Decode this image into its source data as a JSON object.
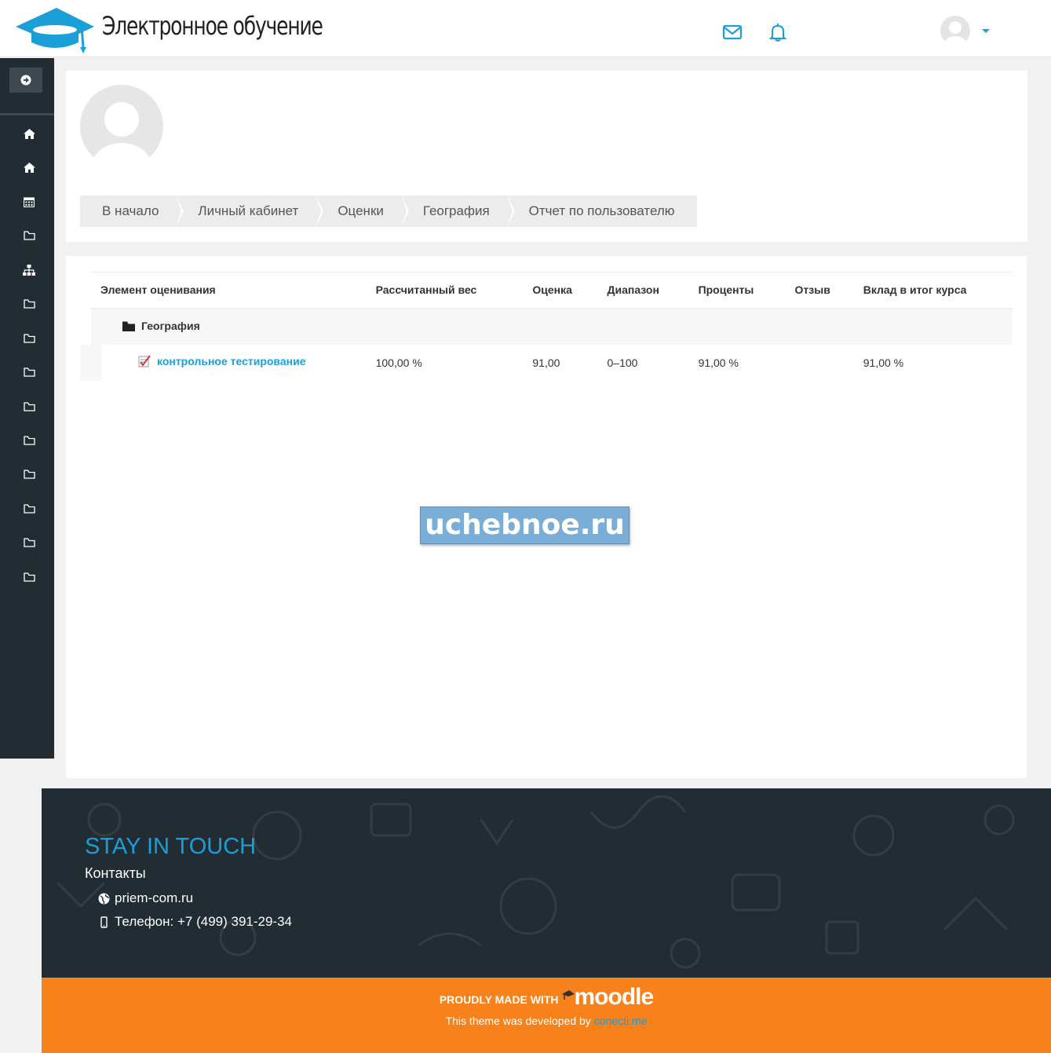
{
  "header": {
    "site_title": "Электронное обучение",
    "icons": [
      "mail-icon",
      "bell-icon",
      "user-avatar"
    ]
  },
  "sidebar": {
    "items": [
      {
        "icon": "home-icon"
      },
      {
        "icon": "home-icon"
      },
      {
        "icon": "calendar-icon"
      },
      {
        "icon": "folder-icon"
      },
      {
        "icon": "sitemap-icon"
      },
      {
        "icon": "folder-icon"
      },
      {
        "icon": "folder-icon"
      },
      {
        "icon": "folder-icon"
      },
      {
        "icon": "folder-icon"
      },
      {
        "icon": "folder-icon"
      },
      {
        "icon": "folder-icon"
      },
      {
        "icon": "folder-icon"
      },
      {
        "icon": "folder-icon"
      },
      {
        "icon": "folder-icon"
      }
    ]
  },
  "breadcrumb": [
    "В начало",
    "Личный кабинет",
    "Оценки",
    "География",
    "Отчет по пользователю"
  ],
  "grades": {
    "headers": [
      "Элемент оценивания",
      "Рассчитанный вес",
      "Оценка",
      "Диапазон",
      "Проценты",
      "Отзыв",
      "Вклад в итог курса"
    ],
    "category": "География",
    "item": {
      "name": "контрольное тестирование",
      "weight": "100,00 %",
      "grade": "91,00",
      "range": "0–100",
      "percent": "91,00 %",
      "feedback": "",
      "contribution": "91,00 %"
    }
  },
  "watermark": "uchebnoe.ru",
  "footer": {
    "stay_title": "STAY IN TOUCH",
    "contacts_heading": "Контакты",
    "website": "priem-com.ru",
    "phone": "Телефон: +7 (499) 391-29-34",
    "made_with": "PROUDLY MADE WITH",
    "moodle": "moodle",
    "developed_by": "This theme was developed by",
    "developer": "conecti.me"
  },
  "colors": {
    "accent": "#1a9fd8",
    "sidebar": "#212c33",
    "footer_bar": "#f7811a"
  }
}
